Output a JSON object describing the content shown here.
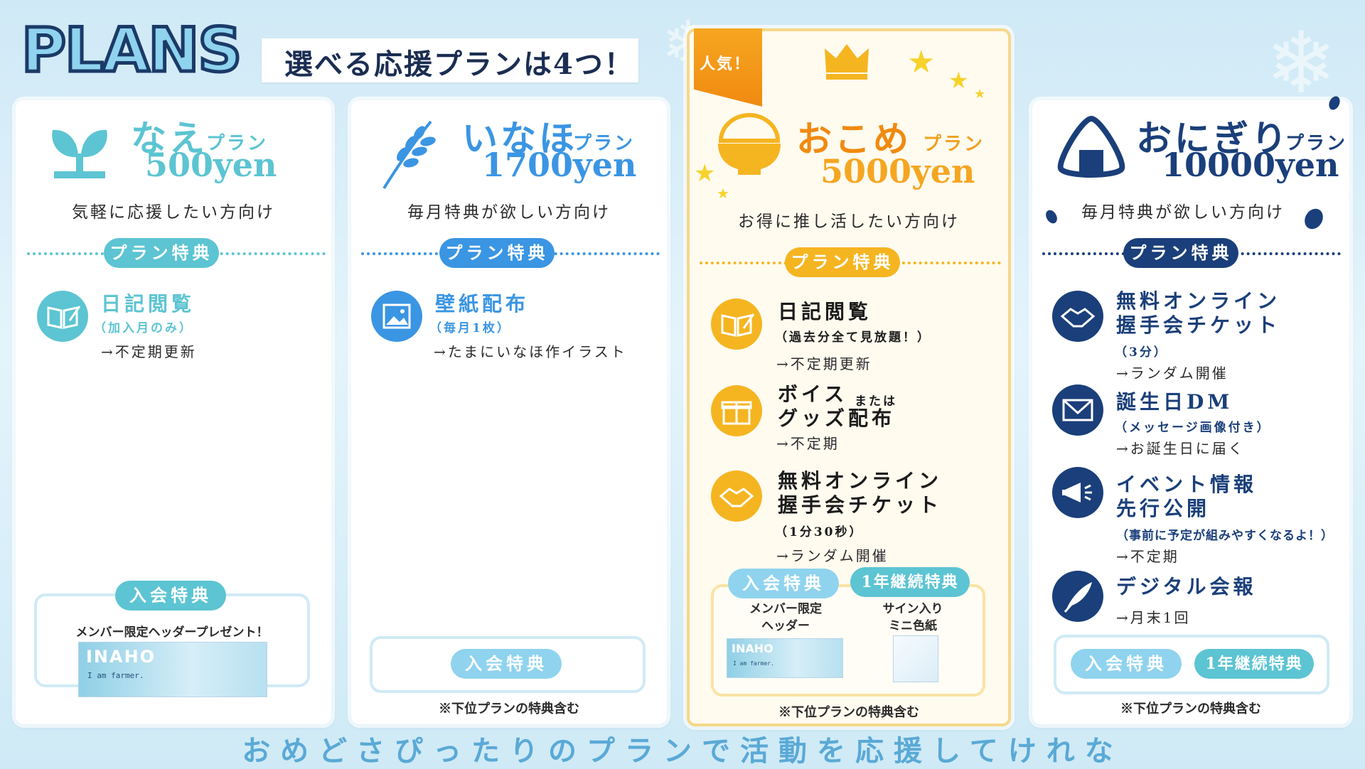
{
  "header": {
    "logo_text": "PLANS",
    "tagline": "選べる応援プランは4つ！"
  },
  "plans": [
    {
      "name": "なえ",
      "suffix": "プラン",
      "price": "500yen",
      "audience": "気軽に応援したい方向け",
      "benefit_label": "プラン特典",
      "benefits": [
        {
          "title": "日記閲覧",
          "sub": "（加入月のみ）",
          "desc": "→不定期更新"
        }
      ],
      "join_label": "入会特典",
      "join_text": "メンバー限定ヘッダープレゼント！",
      "header_img_title": "INAHO",
      "header_img_sub": "I am farmer."
    },
    {
      "name": "いなほ",
      "suffix": "プラン",
      "price": "1700yen",
      "audience": "毎月特典が欲しい方向け",
      "benefit_label": "プラン特典",
      "benefits": [
        {
          "title": "壁紙配布",
          "sub": "（毎月1枚）",
          "desc": "→たまにいなほ作イラスト"
        }
      ],
      "join_label": "入会特典",
      "note": "※下位プランの特典含む"
    },
    {
      "badge": "人気！",
      "name": "おこめ",
      "suffix": "プラン",
      "price": "5000yen",
      "audience": "お得に推し活したい方向け",
      "benefit_label": "プラン特典",
      "benefits": [
        {
          "title": "日記閲覧",
          "sub": "（過去分全て見放題！）",
          "desc": "→不定期更新"
        },
        {
          "title_a": "ボイス",
          "title_mid": "または",
          "title_b": "グッズ配布",
          "desc": "→不定期"
        },
        {
          "title_a": "無料オンライン",
          "title_b": "握手会チケット",
          "sub": "（1分30秒）",
          "desc": "→ランダム開催"
        }
      ],
      "join_label": "入会特典",
      "join_text_a": "メンバー限定",
      "join_text_b": "ヘッダー",
      "cont_label": "1年継続特典",
      "cont_text_a": "サイン入り",
      "cont_text_b": "ミニ色紙",
      "header_img_title": "INAHO",
      "header_img_sub": "I am farmer.",
      "note": "※下位プランの特典含む"
    },
    {
      "name": "おにぎり",
      "suffix": "プラン",
      "price": "10000yen",
      "audience": "毎月特典が欲しい方向け",
      "benefit_label": "プラン特典",
      "benefits": [
        {
          "title_a": "無料オンライン",
          "title_b": "握手会チケット",
          "sub": "（3分）",
          "desc": "→ランダム開催"
        },
        {
          "title": "誕生日DM",
          "sub": "（メッセージ画像付き）",
          "desc": "→お誕生日に届く"
        },
        {
          "title_a": "イベント情報",
          "title_b": "先行公開",
          "sub": "（事前に予定が組みやすくなるよ！）",
          "desc": "→不定期"
        },
        {
          "title": "デジタル会報",
          "desc": "→月末1回"
        }
      ],
      "join_label": "入会特典",
      "cont_label": "1年継続特典",
      "note": "※下位プランの特典含む"
    }
  ],
  "footer": "おめどさぴったりのプランで活動を応援してけれな",
  "colors": {
    "nae": "#5cc4d2",
    "inaho": "#3a95e3",
    "okome": "#f5b521",
    "onigiri": "#1a3f7a",
    "text_dark": "#1b2d52"
  }
}
